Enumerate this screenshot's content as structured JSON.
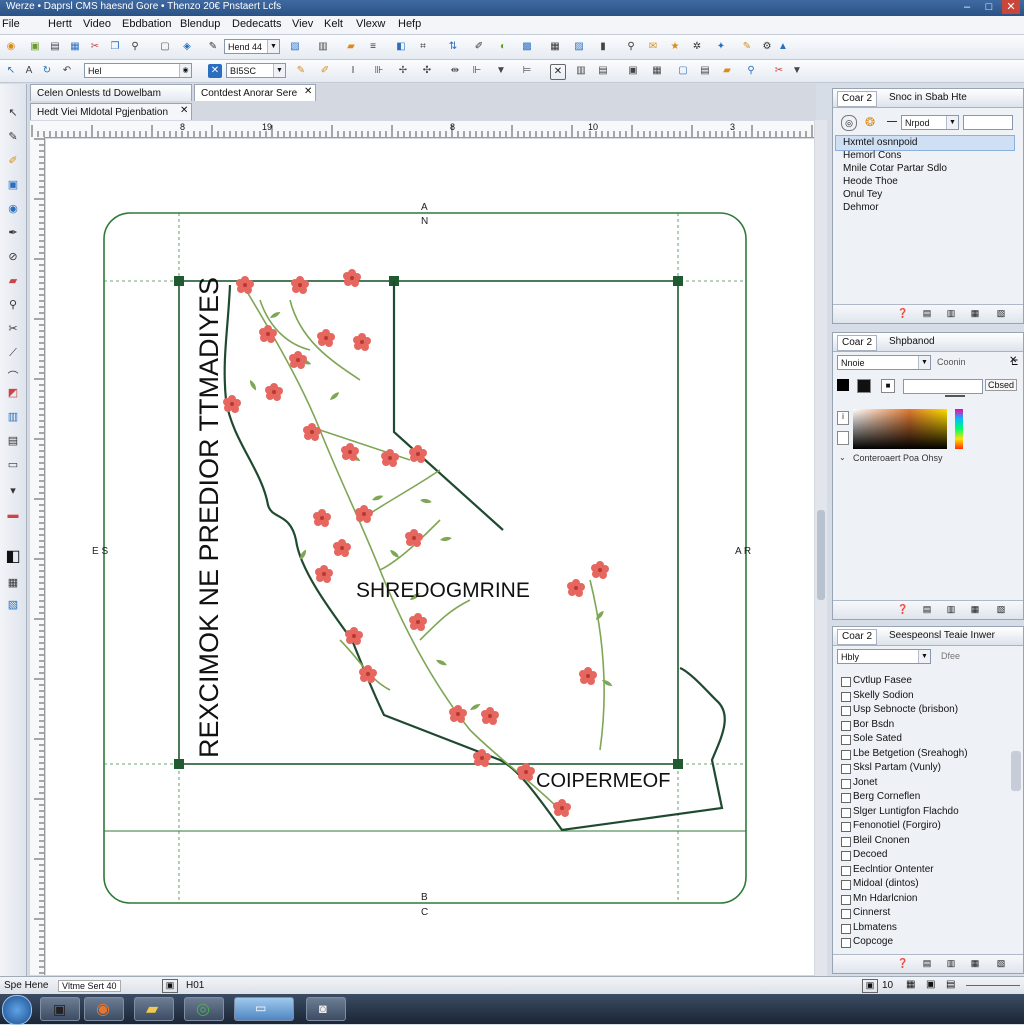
{
  "window": {
    "title": "Werze • Daprsl CMS haesnd Gore • Thenzo 20€ Pnstaert Lcfs",
    "controls": [
      "–",
      "□",
      "✕"
    ]
  },
  "menu": [
    "File",
    "Hertt",
    "Video",
    "Ebdbation",
    "Blendup",
    "Dedecatts",
    "Viev",
    "Kelt",
    "Vlexw",
    "Hefp"
  ],
  "toolbar1": {
    "font_combo": "Hend 44"
  },
  "toolbar2": {
    "size_combo": "Hel",
    "zoom_combo": "BI5SC"
  },
  "document": {
    "tabs": [
      "Celen Onlests td Dowelbam",
      "Contdest Anorar Sere"
    ],
    "subtab": "Hedt Viei Mldotal Pgjenbation",
    "ruler_marks": [
      "8",
      "19",
      "8",
      "10",
      "3"
    ],
    "guide_letters": {
      "top": [
        "A",
        "N"
      ],
      "bottom": [
        "B",
        "C"
      ],
      "left": "E S",
      "right": "A R"
    },
    "vertical_text": "REXCIMOK NE PREDIOR TTMADIYES",
    "center_text": "SHREDOGMRINE",
    "bottom_text": "COIPERMEOF",
    "colors": {
      "frame": "#2f7a3a",
      "outline": "#1f4a30",
      "flower": "#e0564e",
      "leaf": "#7ea654"
    }
  },
  "panel1": {
    "tabs": [
      "Coar 2",
      "Snoc in Sbab Hte"
    ],
    "combo": "Nrpod",
    "items": [
      "Hxmtel osnnpoid",
      "Hemorl Cons",
      "Mnile Cotar Partar Sdlo",
      "Heode Thoe",
      "Onul Tey",
      "Dehmor"
    ]
  },
  "panel2": {
    "tabs": [
      "Coar 2",
      "Shpbanod"
    ],
    "combo": "Nnoie",
    "combo_label": "Coonin",
    "swatch_button": "Cbsed",
    "caption": "Conteroaert Poa Ohsy"
  },
  "panel3": {
    "tabs": [
      "Coar 2",
      "Seespeonsl Teaie Inwer"
    ],
    "combo": "Hbly",
    "combo_label": "Dfee",
    "items": [
      "Cvtlup Fasee",
      "Skelly Sodion",
      "Usp Sebnocte (brisbon)",
      "Bor Bsdn",
      "Sole Sated",
      "Lbe Betgetion (Sreahogh)",
      "Sksl Partam (Vunly)",
      "Jonet",
      "Berg Corneflen",
      "Slger Luntigfon Flachdo",
      "Fenonotiel (Forgiro)",
      "Bleil Cnonen",
      "Decoed",
      "Eeclntior Ontenter",
      "Midoal (dintos)",
      "Mn Hdarlcnion",
      "Cinnerst",
      "Lbmatens",
      "Copcoge"
    ]
  },
  "status": {
    "left": "Spe Hene",
    "mid": "Vltme Sert 40",
    "page": "H01",
    "zoom_r": "10"
  }
}
